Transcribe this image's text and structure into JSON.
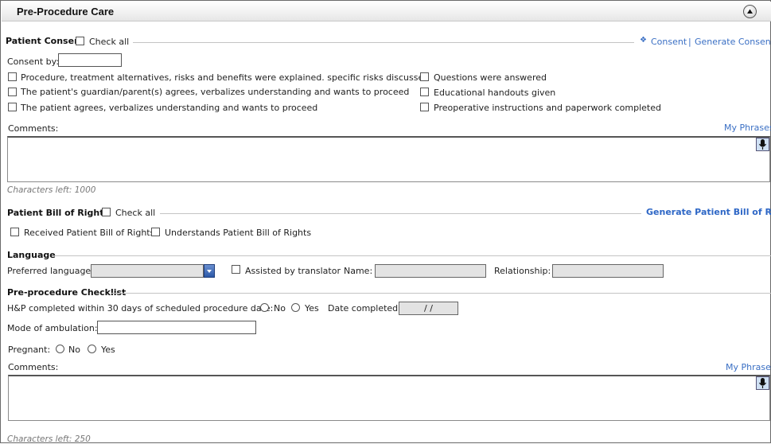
{
  "window": {
    "title": "Pre-Procedure Care"
  },
  "consent": {
    "heading": "Patient Consent",
    "check_all": "Check all",
    "links": {
      "consent": "Consent",
      "separator": "|",
      "generate": "Generate Consent"
    },
    "consent_by_label": "Consent by:",
    "consent_by_value": "",
    "left_items": [
      "Procedure, treatment alternatives, risks and benefits were explained. specific risks discussed",
      "The patient's guardian/parent(s) agrees, verbalizes understanding and wants to proceed",
      "The patient agrees, verbalizes understanding and wants to proceed"
    ],
    "right_items": [
      "Questions were answered",
      "Educational handouts given",
      "Preoperative instructions and paperwork completed"
    ],
    "comments_label": "Comments:",
    "my_phrases": "My Phrases",
    "chars_left": "Characters left: 1000"
  },
  "bill_of_rights": {
    "heading": "Patient Bill of Rights",
    "check_all": "Check all",
    "generate": "Generate Patient Bill of Rights",
    "items": [
      "Received Patient Bill of Rights",
      "Understands Patient Bill of Rights"
    ]
  },
  "language": {
    "heading": "Language",
    "preferred_label": "Preferred language:",
    "preferred_value": "",
    "assisted_label": "Assisted by translator",
    "name_label": "Name:",
    "relationship_label": "Relationship:"
  },
  "checklist": {
    "heading": "Pre-procedure Checklist",
    "hp_label": "H&P completed within 30 days of scheduled procedure date:",
    "no": "No",
    "yes": "Yes",
    "date_label": "Date completed:",
    "date_value": "/ /",
    "mode_label": "Mode of ambulation:",
    "pregnant_label": "Pregnant:",
    "comments_label": "Comments:",
    "my_phrases": "My Phrases",
    "chars_left": "Characters left: 250"
  }
}
